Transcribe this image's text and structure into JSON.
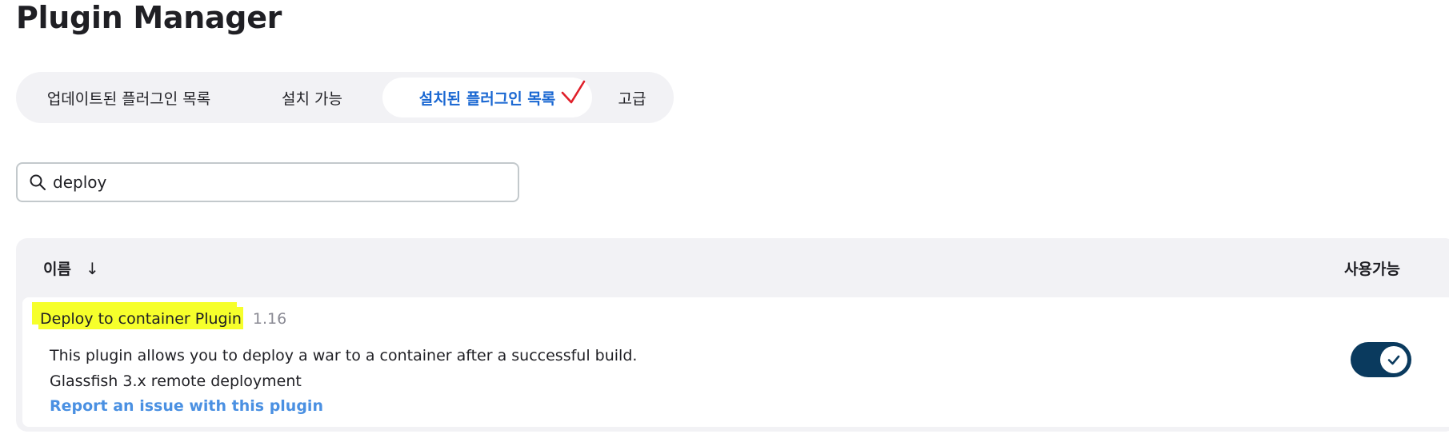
{
  "page": {
    "title": "Plugin Manager"
  },
  "tabs": [
    {
      "label": "업데이트된 플러그인 목록",
      "active": false
    },
    {
      "label": "설치 가능",
      "active": false
    },
    {
      "label": "설치된 플러그인 목록",
      "active": true
    },
    {
      "label": "고급",
      "active": false
    }
  ],
  "search": {
    "value": "deploy",
    "icon": "search-icon"
  },
  "table": {
    "columns": {
      "name": "이름",
      "sort_indicator": "↓",
      "enabled": "사용가능"
    },
    "rows": [
      {
        "name": "Deploy to container Plugin",
        "version": "1.16",
        "description_lines": [
          "This plugin allows you to deploy a war to a container after a successful build.",
          "Glassfish 3.x remote deployment"
        ],
        "report_link": "Report an issue with this plugin",
        "enabled": true
      }
    ]
  },
  "colors": {
    "accent": "#1967d2",
    "link": "#4a90e2",
    "toggle_on": "#0a3a5e",
    "highlight": "#f6ff2b",
    "annotation": "#e0202a"
  }
}
